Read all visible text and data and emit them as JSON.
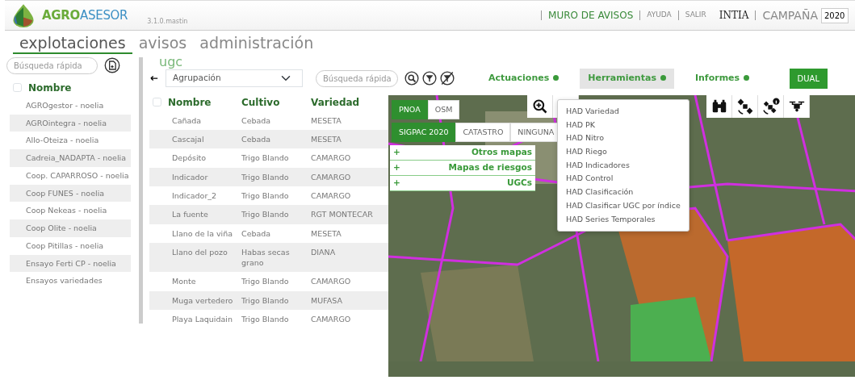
{
  "header": {
    "brand_first": "AGRO",
    "brand_second": "ASESOR",
    "version": "3.1.0.mastin",
    "links": [
      {
        "label": "MURO DE AVISOS",
        "kind": "primary"
      },
      {
        "label": "AYUDA",
        "kind": "small"
      },
      {
        "label": "SALIR",
        "kind": "small"
      }
    ],
    "user": "INTIA",
    "campaign_label": "CAMPAÑA",
    "campaign_value": "2020"
  },
  "main_tabs": [
    {
      "label": "explotaciones",
      "selected": true
    },
    {
      "label": "avisos",
      "selected": false
    },
    {
      "label": "administración",
      "selected": false
    }
  ],
  "sidebar": {
    "search_placeholder": "Búsqueda rápida",
    "header": {
      "label": "Nombre",
      "checked": false
    },
    "items": [
      {
        "label": "AGROgestor - noelia"
      },
      {
        "label": "AGROintegra - noelia"
      },
      {
        "label": "Allo-Oteiza - noelia"
      },
      {
        "label": "Cadreia_NADAPTA - noelia"
      },
      {
        "label": "Coop. CAPARROSO - noelia"
      },
      {
        "label": "Coop FUNES - noelia"
      },
      {
        "label": "Coop Nekeas - noelia"
      },
      {
        "label": "Coop Olite - noelia"
      },
      {
        "label": "Coop Pitillas - noelia"
      },
      {
        "label": "Ensayo Ferti CP - noelia"
      },
      {
        "label": "Ensayos variedades"
      }
    ]
  },
  "section_title": "ugc",
  "toolbar": {
    "group_select": "Agrupación",
    "search_placeholder": "Búsqueda rápida",
    "menus": [
      {
        "label": "Actuaciones",
        "open": false
      },
      {
        "label": "Herramientas",
        "open": true
      },
      {
        "label": "Informes",
        "open": false
      }
    ],
    "view_button": {
      "label": "DUAL",
      "selected": true
    }
  },
  "tools_menu": [
    "HAD Variedad",
    "HAD PK",
    "HAD Nitro",
    "HAD Riego",
    "HAD Indicadores",
    "HAD Control",
    "HAD Clasificación",
    "HAD Clasificar UGC por índice",
    "HAD Series Temporales"
  ],
  "table": {
    "header_checked": false,
    "columns": [
      "Nombre",
      "Cultivo",
      "Variedad"
    ],
    "rows": [
      [
        "Cañada",
        "Cebada",
        "MESETA"
      ],
      [
        "Cascajal",
        "Cebada",
        "MESETA"
      ],
      [
        "Depósito",
        "Trigo Blando",
        "CAMARGO"
      ],
      [
        "Indicador",
        "Trigo Blando",
        "CAMARGO"
      ],
      [
        "Indicador_2",
        "Trigo Blando",
        "CAMARGO"
      ],
      [
        "La fuente",
        "Trigo Blando",
        "RGT MONTECAR"
      ],
      [
        "Llano de la viña",
        "Cebada",
        "MESETA"
      ],
      [
        "Llano del pozo",
        "Habas secas grano",
        "DIANA"
      ],
      [
        "Monte",
        "Trigo Blando",
        "CAMARGO"
      ],
      [
        "Muga vertedero",
        "Trigo Blando",
        "MUFASA"
      ],
      [
        "Playa Laquidain",
        "Trigo Blando",
        "CAMARGO"
      ]
    ]
  },
  "map": {
    "base_layers": [
      {
        "label": "PNOA",
        "selected": true
      },
      {
        "label": "OSM",
        "selected": false
      }
    ],
    "overlay_layers": [
      {
        "label": "SIGPAC 2020",
        "selected": true
      },
      {
        "label": "CATASTRO",
        "selected": false
      },
      {
        "label": "NINGUNA",
        "selected": false
      }
    ],
    "panels": [
      {
        "toggle": "+",
        "label": "Otros mapas"
      },
      {
        "toggle": "+",
        "label": "Mapas de riesgos"
      },
      {
        "toggle": "+",
        "label": "UGCs"
      }
    ]
  }
}
